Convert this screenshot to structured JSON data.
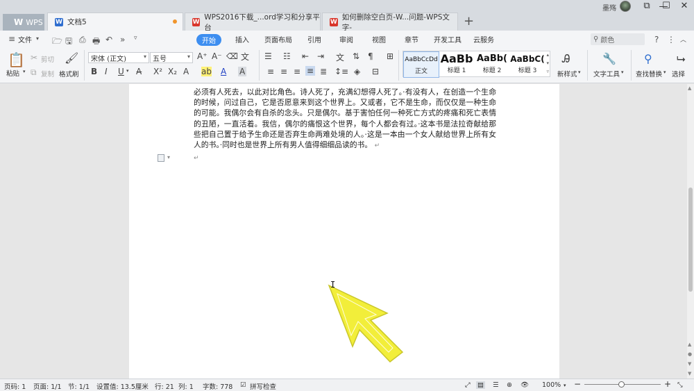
{
  "titlebar": {
    "app_tab": "WPS",
    "tabs": [
      {
        "label": "文档5",
        "icon": "W"
      },
      {
        "label": "WPS2016下载_...ord学习和分享平台",
        "icon": "W"
      },
      {
        "label": "如何删除空白页-W...问题-WPS文字-",
        "icon": "W"
      }
    ],
    "add_tab": "+",
    "user": "墨殇",
    "window": {
      "restore": "⧉",
      "minimize": "—",
      "maximize": "☐",
      "close": "✕"
    }
  },
  "menu": {
    "file": "文件",
    "tabs": [
      "开始",
      "插入",
      "页面布局",
      "引用",
      "审阅",
      "视图",
      "章节",
      "开发工具",
      "云服务"
    ],
    "search_placeholder": "颜色"
  },
  "toolbar": {
    "paste": "粘贴",
    "cut": "剪切",
    "copy": "复制",
    "format_painter": "格式刷",
    "font_name": "宋体 (正文)",
    "font_size": "五号",
    "styles": [
      {
        "sample": "AaBbCcDd",
        "name": "正文"
      },
      {
        "sample": "AaBb",
        "name": "标题 1"
      },
      {
        "sample": "AaBb(",
        "name": "标题 2"
      },
      {
        "sample": "AaBbC(",
        "name": "标题 3"
      }
    ],
    "new_style": "新样式",
    "text_tools": "文字工具",
    "find_replace": "查找替换",
    "select": "选择"
  },
  "document": {
    "paragraph": "必须有人死去，以此对比角色。诗人死了，充满幻想得人死了。·有没有人，在创造一个生命的时候，问过自己，它是否愿意来到这个世界上。又或者，它不是生命，而仅仅是一种生命的可能。我偶尔会有自杀的念头。只是偶尔。基于害怕任何一种死亡方式的疼痛和死亡表情的丑陋，一直活着。我信，偶尔的痛恨这个世界，每个人都会有过。·这本书是法拉奇献给那些把自己置于给予生命还是否弃生命两难处境的人。·这是一本由一个女人献给世界上所有女人的书。·同时也是世界上所有男人值得细细品读的书。",
    "paragraph_mark": "↵",
    "empty_mark": "↵"
  },
  "statusbar": {
    "page_num": "页码: 1",
    "pages": "页面: 1/1",
    "section": "节: 1/1",
    "position": "设置值: 13.5厘米",
    "row": "行: 21",
    "col": "列: 1",
    "words": "字数: 778",
    "spell": "拼写检查",
    "zoom": "100%"
  },
  "colors": {
    "accent": "#3d8ef0",
    "titlebar": "#d7dbe0",
    "ribbon": "#f4f5f7",
    "highlight_arrow": "#f2ee3a"
  }
}
